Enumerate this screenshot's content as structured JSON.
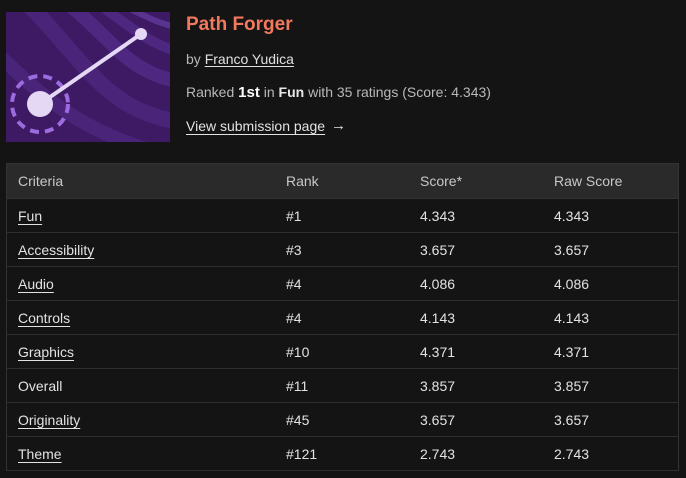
{
  "game": {
    "title": "Path Forger",
    "by_prefix": "by",
    "author": "Franco Yudica",
    "ranked_prefix": "Ranked",
    "rank": "1st",
    "in_text": "in",
    "category": "Fun",
    "with_text": "with 35 ratings (Score: 4.343)",
    "view_link": "View submission page",
    "arrow_icon": "→",
    "thumbnail": {
      "icon": "path-forger-thumbnail",
      "background": "#3d1a63",
      "stripe": "#4e2880",
      "accent": "#e4d8f5",
      "ring": "#9c6be0"
    }
  },
  "colors": {
    "title": "#f2785e",
    "background": "#141414",
    "header_row": "#2a2a2a"
  },
  "table": {
    "headers": [
      "Criteria",
      "Rank",
      "Score*",
      "Raw Score"
    ],
    "rows": [
      {
        "criteria": "Fun",
        "rank": "#1",
        "score": "4.343",
        "raw": "4.343",
        "link": true
      },
      {
        "criteria": "Accessibility",
        "rank": "#3",
        "score": "3.657",
        "raw": "3.657",
        "link": true
      },
      {
        "criteria": "Audio",
        "rank": "#4",
        "score": "4.086",
        "raw": "4.086",
        "link": true
      },
      {
        "criteria": "Controls",
        "rank": "#4",
        "score": "4.143",
        "raw": "4.143",
        "link": true
      },
      {
        "criteria": "Graphics",
        "rank": "#10",
        "score": "4.371",
        "raw": "4.371",
        "link": true
      },
      {
        "criteria": "Overall",
        "rank": "#11",
        "score": "3.857",
        "raw": "3.857",
        "link": false
      },
      {
        "criteria": "Originality",
        "rank": "#45",
        "score": "3.657",
        "raw": "3.657",
        "link": true
      },
      {
        "criteria": "Theme",
        "rank": "#121",
        "score": "2.743",
        "raw": "2.743",
        "link": true
      }
    ]
  }
}
